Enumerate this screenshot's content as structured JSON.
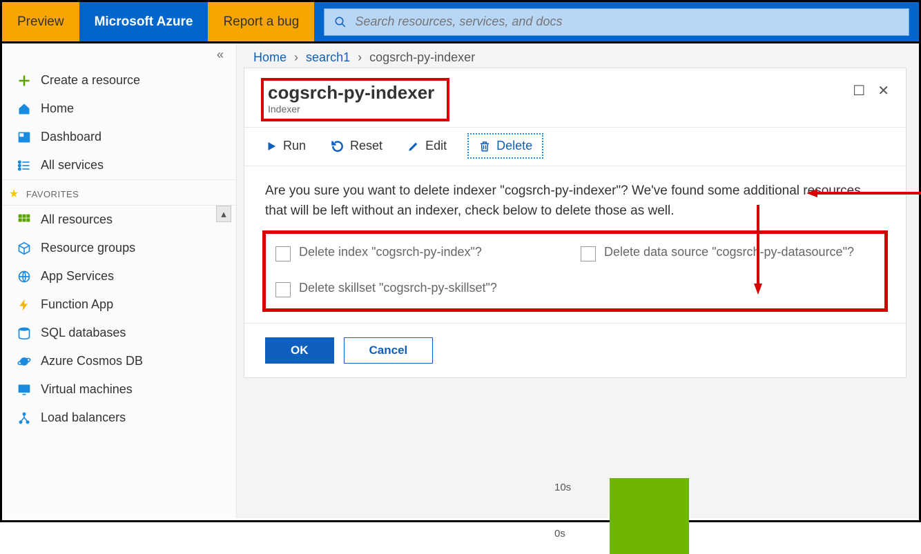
{
  "topbar": {
    "preview": "Preview",
    "brand": "Microsoft Azure",
    "report_bug": "Report a bug",
    "search_placeholder": "Search resources, services, and docs"
  },
  "sidebar": {
    "collapse_glyph": "«",
    "create": "Create a resource",
    "home": "Home",
    "dashboard": "Dashboard",
    "all_services": "All services",
    "favorites_label": "FAVORITES",
    "all_resources": "All resources",
    "resource_groups": "Resource groups",
    "app_services": "App Services",
    "function_app": "Function App",
    "sql_databases": "SQL databases",
    "cosmos": "Azure Cosmos DB",
    "vms": "Virtual machines",
    "load_balancers": "Load balancers"
  },
  "breadcrumb": {
    "home": "Home",
    "search": "search1",
    "current": "cogsrch-py-indexer"
  },
  "panel": {
    "title": "cogsrch-py-indexer",
    "subtitle": "Indexer"
  },
  "toolbar": {
    "run": "Run",
    "reset": "Reset",
    "edit": "Edit",
    "delete": "Delete"
  },
  "confirm": {
    "message": "Are you sure you want to delete indexer \"cogsrch-py-indexer\"? We've found some additional resources that will be left without an indexer, check below to delete those as well.",
    "opt_index": "Delete index \"cogsrch-py-index\"?",
    "opt_datasource": "Delete data source \"cogsrch-py-datasource\"?",
    "opt_skillset": "Delete skillset \"cogsrch-py-skillset\"?"
  },
  "actions": {
    "ok": "OK",
    "cancel": "Cancel"
  },
  "chart_ticks": {
    "t10": "10s",
    "t0": "0s"
  }
}
